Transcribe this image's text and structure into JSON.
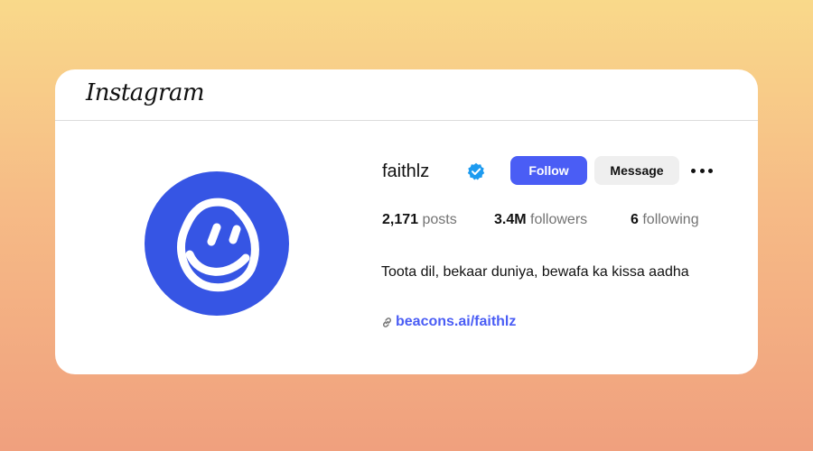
{
  "brand": {
    "logo_text": "Instagram"
  },
  "profile": {
    "username": "faithlz",
    "verified": true,
    "avatar": {
      "icon": "smiley-face-icon",
      "background_color": "#3655e4"
    },
    "buttons": {
      "follow_label": "Follow",
      "message_label": "Message",
      "more": "more-options-icon"
    },
    "stats": [
      {
        "value": "2,171",
        "label": "posts"
      },
      {
        "value": "3.4M",
        "label": "followers"
      },
      {
        "value": "6",
        "label": "following"
      }
    ],
    "bio": "Toota dil, bekaar duniya, bewafa ka kissa aadha",
    "link": {
      "icon": "link-icon",
      "text": "beacons.ai/faithlz"
    }
  },
  "colors": {
    "accent": "#4a5df5",
    "verified_badge": "#1d9bf0"
  }
}
